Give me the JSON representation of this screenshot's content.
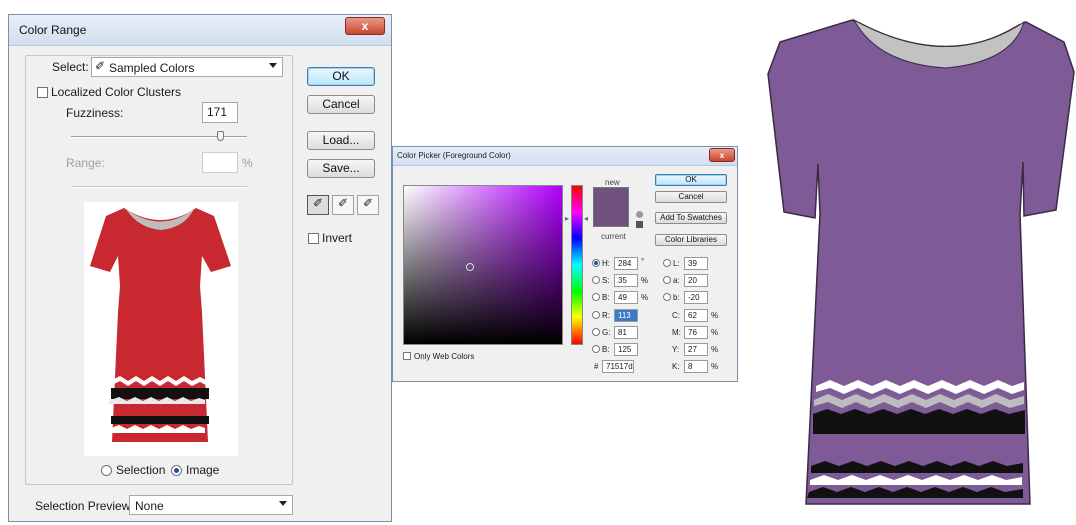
{
  "color_range": {
    "title": "Color Range",
    "close_symbol": "x",
    "select_label": "Select:",
    "select_value": "Sampled Colors",
    "localized_label": "Localized Color Clusters",
    "fuzziness_label": "Fuzziness:",
    "fuzziness_value": "171",
    "range_label": "Range:",
    "range_unit": "%",
    "buttons": {
      "ok": "OK",
      "cancel": "Cancel",
      "load": "Load...",
      "save": "Save..."
    },
    "invert_label": "Invert",
    "radio_selection": "Selection",
    "radio_image": "Image",
    "preview_label": "Selection Preview:",
    "preview_value": "None",
    "preview_dress_color": "#c8282f"
  },
  "color_picker": {
    "title": "Color Picker (Foreground Color)",
    "close_symbol": "x",
    "new_label": "new",
    "current_label": "current",
    "new_color": "#71517d",
    "current_color": "#71517d",
    "buttons": {
      "ok": "OK",
      "cancel": "Cancel",
      "swatches": "Add To Swatches",
      "libraries": "Color Libraries"
    },
    "fields": {
      "h_label": "H:",
      "h_value": "284",
      "h_unit": "°",
      "s_label": "S:",
      "s_value": "35",
      "s_unit": "%",
      "b_label": "B:",
      "b_value": "49",
      "b_unit": "%",
      "r_label": "R:",
      "r_value": "113",
      "g_label": "G:",
      "g_value": "81",
      "bb_label": "B:",
      "bb_value": "125",
      "l_label": "L:",
      "l_value": "39",
      "a_label": "a:",
      "a_value": "20",
      "lb_label": "b:",
      "lb_value": "-20",
      "c_label": "C:",
      "c_value": "62",
      "c_unit": "%",
      "m_label": "M:",
      "m_value": "76",
      "m_unit": "%",
      "y_label": "Y:",
      "y_value": "27",
      "y_unit": "%",
      "k_label": "K:",
      "k_value": "8",
      "k_unit": "%",
      "hex_label": "#",
      "hex_value": "71517d"
    },
    "web_colors_label": "Only Web Colors"
  },
  "result_dress": {
    "color": "#7e5a96"
  }
}
